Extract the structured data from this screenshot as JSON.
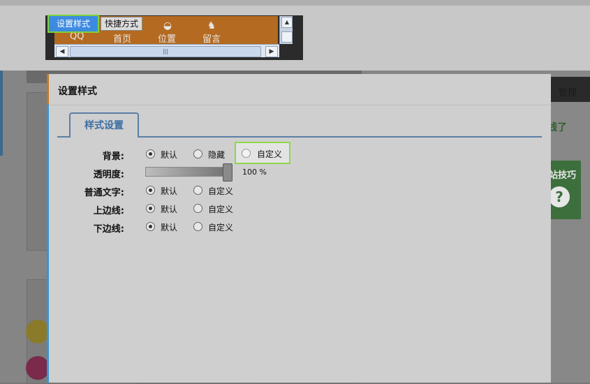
{
  "preview": {
    "tabs": {
      "style_label": "设置样式",
      "shortcut_label": "快捷方式"
    },
    "nav_items": [
      {
        "label": "QQ",
        "icon": "qq-icon"
      },
      {
        "label": "首页",
        "icon": "home-icon"
      },
      {
        "label": "位置",
        "icon": "location-icon"
      },
      {
        "label": "留言",
        "icon": "android-icon"
      }
    ],
    "scroll_thumb_grip": "|||"
  },
  "background": {
    "manage_label": "管理",
    "online_text": "上线了",
    "tips_text": "站技巧",
    "tips_icon": "?"
  },
  "dialog": {
    "title": "设置样式",
    "tab_label": "样式设置",
    "rows": {
      "background": {
        "label": "背景:",
        "options": [
          "默认",
          "隐藏",
          "自定义"
        ],
        "selected": "默认"
      },
      "opacity": {
        "label": "透明度:",
        "value_text": "100 %",
        "value": 100
      },
      "text": {
        "label": "普通文字:",
        "options": [
          "默认",
          "自定义"
        ],
        "selected": "默认"
      },
      "top_border": {
        "label": "上边线:",
        "options": [
          "默认",
          "自定义"
        ],
        "selected": "默认"
      },
      "bottom_border": {
        "label": "下边线:",
        "options": [
          "默认",
          "自定义"
        ],
        "selected": "默认"
      }
    }
  },
  "colors": {
    "accent_green": "#8ed84a",
    "tab_blue": "#3d8be0",
    "dialog_bg": "#cfcfcf",
    "nav_orange": "#b46a20"
  }
}
